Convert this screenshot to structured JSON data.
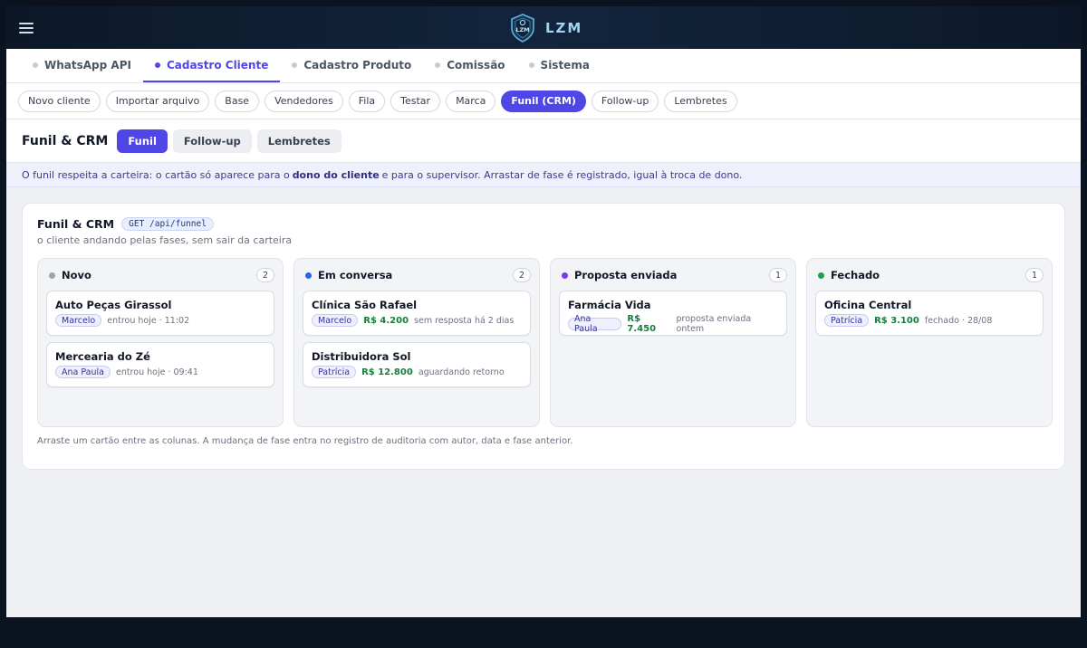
{
  "header": {
    "brand": "LZM",
    "logo_text": "LZM"
  },
  "main_tabs": [
    {
      "label": "WhatsApp API",
      "active": false
    },
    {
      "label": "Cadastro Cliente",
      "active": true
    },
    {
      "label": "Cadastro Produto",
      "active": false
    },
    {
      "label": "Comissão",
      "active": false
    },
    {
      "label": "Sistema",
      "active": false
    }
  ],
  "sub_tabs": [
    {
      "label": "Novo cliente",
      "active": false
    },
    {
      "label": "Importar arquivo",
      "active": false
    },
    {
      "label": "Base",
      "active": false
    },
    {
      "label": "Vendedores",
      "active": false
    },
    {
      "label": "Fila",
      "active": false
    },
    {
      "label": "Testar",
      "active": false
    },
    {
      "label": "Marca",
      "active": false
    },
    {
      "label": "Funil (CRM)",
      "active": true
    },
    {
      "label": "Follow-up",
      "active": false
    },
    {
      "label": "Lembretes",
      "active": false
    }
  ],
  "section": {
    "title": "Funil & CRM",
    "toggles": [
      {
        "label": "Funil",
        "active": true
      },
      {
        "label": "Follow-up",
        "active": false
      },
      {
        "label": "Lembretes",
        "active": false
      }
    ]
  },
  "notice": {
    "before": "O funil respeita a carteira: o cartão só aparece para o",
    "bold": "dono do cliente",
    "after": "e para o supervisor. Arrastar de fase é registrado, igual à troca de dono."
  },
  "panel": {
    "title": "Funil & CRM",
    "endpoint": "GET /api/funnel",
    "subtitle": "o cliente andando pelas fases, sem sair da carteira",
    "footer": "Arraste um cartão entre as colunas. A mudança de fase entra no registro de auditoria com autor, data e fase anterior."
  },
  "columns": [
    {
      "name": "Novo",
      "count": "2",
      "color": "#9ca3af",
      "cards": [
        {
          "title": "Auto Peças Girassol",
          "owner": "Marcelo",
          "amount": "",
          "note": "entrou hoje · 11:02"
        },
        {
          "title": "Mercearia do Zé",
          "owner": "Ana Paula",
          "amount": "",
          "note": "entrou hoje · 09:41"
        }
      ]
    },
    {
      "name": "Em conversa",
      "count": "2",
      "color": "#2563eb",
      "cards": [
        {
          "title": "Clínica São Rafael",
          "owner": "Marcelo",
          "amount": "R$ 4.200",
          "note": "sem resposta há 2 dias"
        },
        {
          "title": "Distribuidora Sol",
          "owner": "Patrícia",
          "amount": "R$ 12.800",
          "note": "aguardando retorno"
        }
      ]
    },
    {
      "name": "Proposta enviada",
      "count": "1",
      "color": "#7c3aed",
      "cards": [
        {
          "title": "Farmácia Vida",
          "owner": "Ana Paula",
          "amount": "R$ 7.450",
          "note": "proposta enviada ontem"
        }
      ]
    },
    {
      "name": "Fechado",
      "count": "1",
      "color": "#16a34a",
      "cards": [
        {
          "title": "Oficina Central",
          "owner": "Patrícia",
          "amount": "R$ 3.100",
          "note": "fechado · 28/08"
        }
      ]
    }
  ]
}
